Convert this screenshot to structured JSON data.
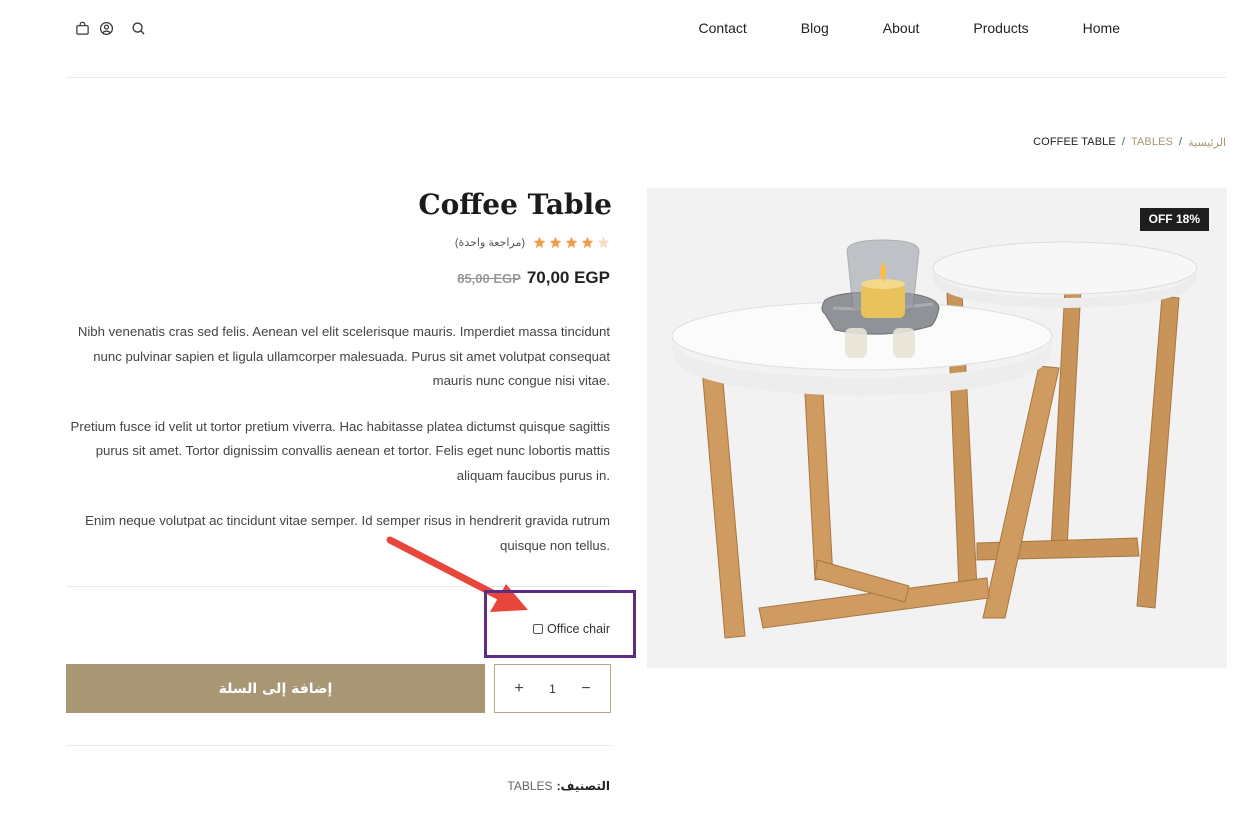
{
  "header": {
    "icons": [
      "cart-icon",
      "account-icon",
      "search-icon"
    ],
    "nav": [
      "Contact",
      "Blog",
      "About",
      "Products",
      "Home"
    ]
  },
  "breadcrumb": {
    "home": "الرئيسية",
    "category": "TABLES",
    "current": "COFFEE TABLE",
    "separator": "/"
  },
  "product": {
    "title": "Coffee Table",
    "rating": 4,
    "rating_max": 5,
    "review_text": "(مراجعة واحدة)",
    "price_old": "85,00 EGP",
    "price_new": "70,00 EGP",
    "sale_badge": "OFF 18%",
    "description": [
      "Nibh venenatis cras sed felis. Aenean vel elit scelerisque mauris. Imperdiet massa tincidunt nunc pulvinar sapien et ligula ullamcorper malesuada. Purus sit amet volutpat consequat mauris nunc congue nisi vitae.",
      "Pretium fusce id velit ut tortor pretium viverra. Hac habitasse platea dictumst quisque sagittis purus sit amet. Tortor dignissim convallis aenean et tortor. Felis eget nunc lobortis mattis aliquam faucibus purus in.",
      "Enim neque volutpat ac tincidunt vitae semper. Id semper risus in hendrerit gravida rutrum quisque non tellus."
    ],
    "addon_label": "Office chair",
    "addon_checked": false,
    "add_to_cart": "إضافة إلى السلة",
    "quantity": "1",
    "qty_minus": "−",
    "qty_plus": "+",
    "category_label": "التصنيف:",
    "category_value": "TABLES"
  },
  "colors": {
    "accent": "#a89675",
    "badge_bg": "#1e1e1e",
    "highlight_box": "#5b2d87",
    "annotation_arrow": "#e8463a",
    "star": "#f0a04b"
  }
}
